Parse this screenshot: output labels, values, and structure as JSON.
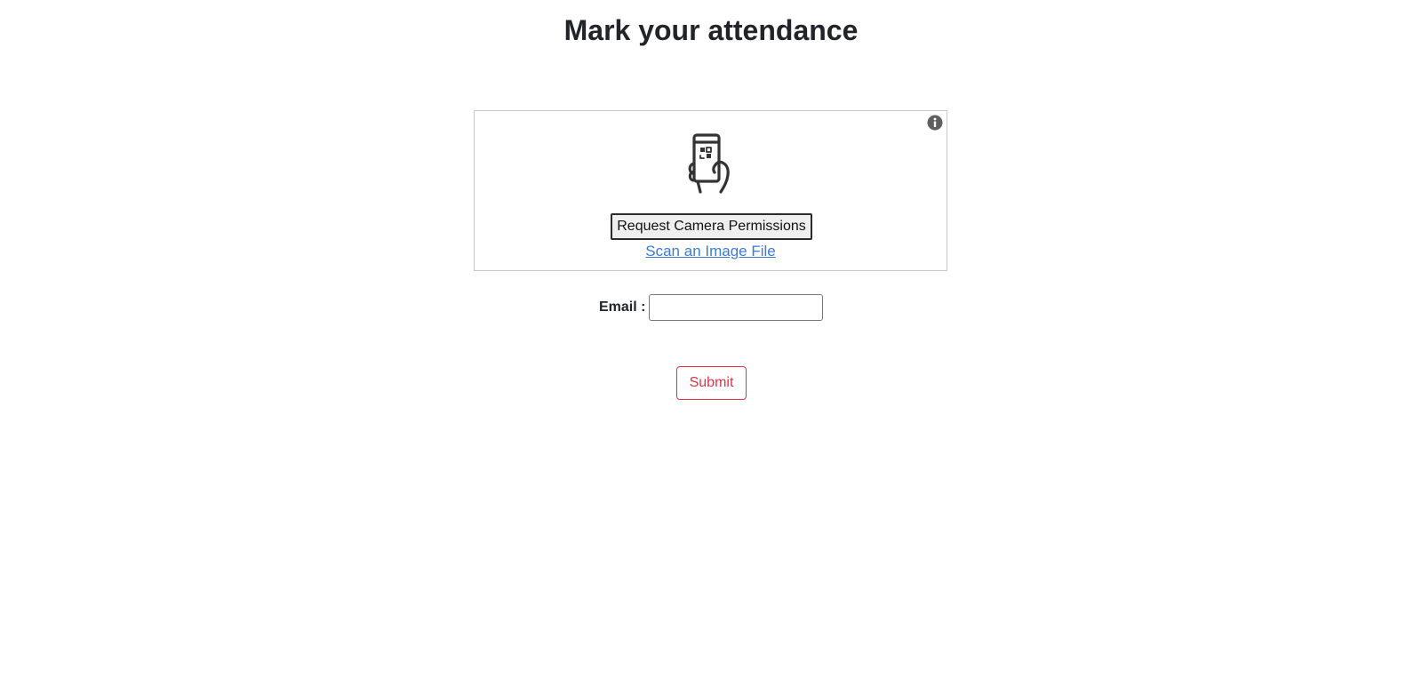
{
  "page": {
    "title": "Mark your attendance"
  },
  "scanner": {
    "info_icon": "info-icon",
    "illustration_icon": "phone-qr-scan-icon",
    "camera_button_label": "Request Camera Permissions",
    "scan_file_link": "Scan an Image File"
  },
  "form": {
    "email_label": "Email :",
    "email_value": "",
    "submit_label": "Submit"
  },
  "colors": {
    "submit_accent": "#dc3545",
    "link": "#3a7bd5",
    "icon": "#333333"
  }
}
